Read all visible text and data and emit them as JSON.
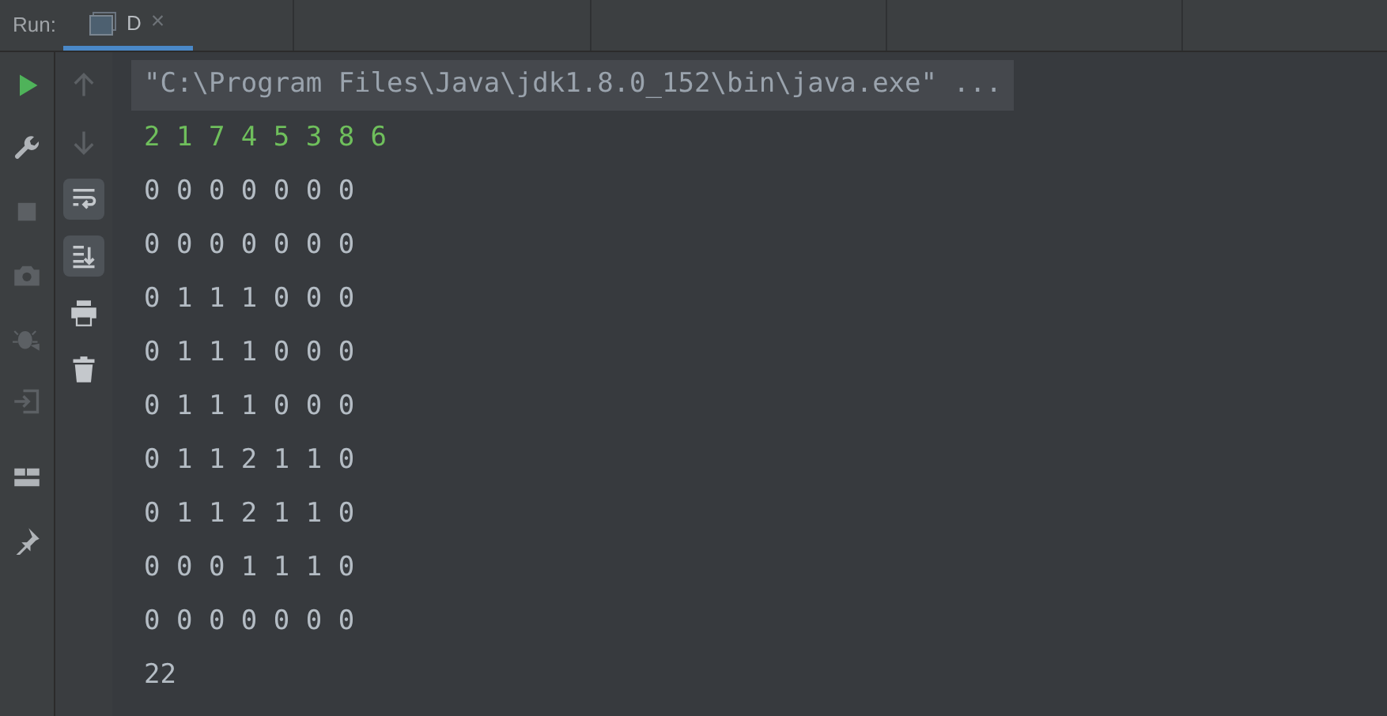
{
  "run_bar": {
    "label": "Run:",
    "tabs": [
      {
        "label": "D",
        "selected": true
      }
    ],
    "close_symbol": "×"
  },
  "left_toolbar": [
    {
      "kind": "run",
      "disabled": false
    },
    {
      "kind": "wrench",
      "disabled": false
    },
    {
      "kind": "stop",
      "disabled": true
    },
    {
      "kind": "camera",
      "disabled": true
    },
    {
      "kind": "bug",
      "disabled": true
    },
    {
      "kind": "enter",
      "disabled": true
    },
    {
      "kind": "layout",
      "disabled": false
    },
    {
      "kind": "pin",
      "disabled": false
    }
  ],
  "console_toolbar": [
    {
      "kind": "up",
      "disabled": true,
      "on": false
    },
    {
      "kind": "down",
      "disabled": true,
      "on": false
    },
    {
      "kind": "wrap",
      "disabled": false,
      "on": true
    },
    {
      "kind": "scroll-end",
      "disabled": false,
      "on": true
    },
    {
      "kind": "print",
      "disabled": false,
      "on": false
    },
    {
      "kind": "trash",
      "disabled": false,
      "on": false
    }
  ],
  "console_lines": [
    {
      "kind": "command",
      "text": "\"C:\\Program Files\\Java\\jdk1.8.0_152\\bin\\java.exe\" ..."
    },
    {
      "kind": "input",
      "text": "2 1 7 4 5 3 8 6"
    },
    {
      "kind": "output",
      "text": "0 0 0 0 0 0 0"
    },
    {
      "kind": "output",
      "text": "0 0 0 0 0 0 0"
    },
    {
      "kind": "output",
      "text": "0 1 1 1 0 0 0"
    },
    {
      "kind": "output",
      "text": "0 1 1 1 0 0 0"
    },
    {
      "kind": "output",
      "text": "0 1 1 1 0 0 0"
    },
    {
      "kind": "output",
      "text": "0 1 1 2 1 1 0"
    },
    {
      "kind": "output",
      "text": "0 1 1 2 1 1 0"
    },
    {
      "kind": "output",
      "text": "0 0 0 1 1 1 0"
    },
    {
      "kind": "output",
      "text": "0 0 0 0 0 0 0"
    },
    {
      "kind": "output",
      "text": "22"
    }
  ]
}
